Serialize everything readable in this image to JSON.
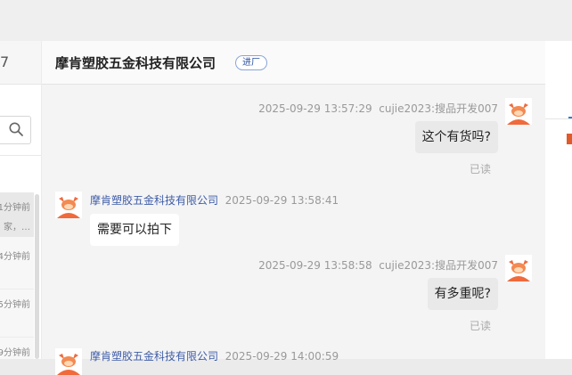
{
  "left": {
    "header_fragment": "7",
    "items": [
      {
        "time": "1分钟前",
        "preview": "家，…"
      },
      {
        "time": "4分钟前"
      },
      {
        "time": "5分钟前"
      },
      {
        "time": "9分钟前"
      }
    ]
  },
  "header": {
    "company": "摩肯塑胶五金科技有限公司",
    "badge": "进厂"
  },
  "messages": [
    {
      "from": "me",
      "time": "2025-09-29 13:57:29",
      "sender": "cujie2023:搜品开发007",
      "text": "这个有货吗?",
      "status": "已读"
    },
    {
      "from": "peer",
      "sender": "摩肯塑胶五金科技有限公司",
      "time": "2025-09-29 13:58:41",
      "text": "需要可以拍下"
    },
    {
      "from": "me",
      "time": "2025-09-29 13:58:58",
      "sender": "cujie2023:搜品开发007",
      "text": "有多重呢?",
      "status": "已读"
    },
    {
      "from": "peer",
      "sender": "摩肯塑胶五金科技有限公司",
      "time": "2025-09-29 14:00:59"
    }
  ],
  "icons": {
    "search": "search-icon",
    "avatar": "cow-avatar-icon"
  },
  "colors": {
    "accent": "#2f7fd6",
    "peer_name": "#3d5ca8",
    "avatar_orange": "#f06a3b"
  }
}
